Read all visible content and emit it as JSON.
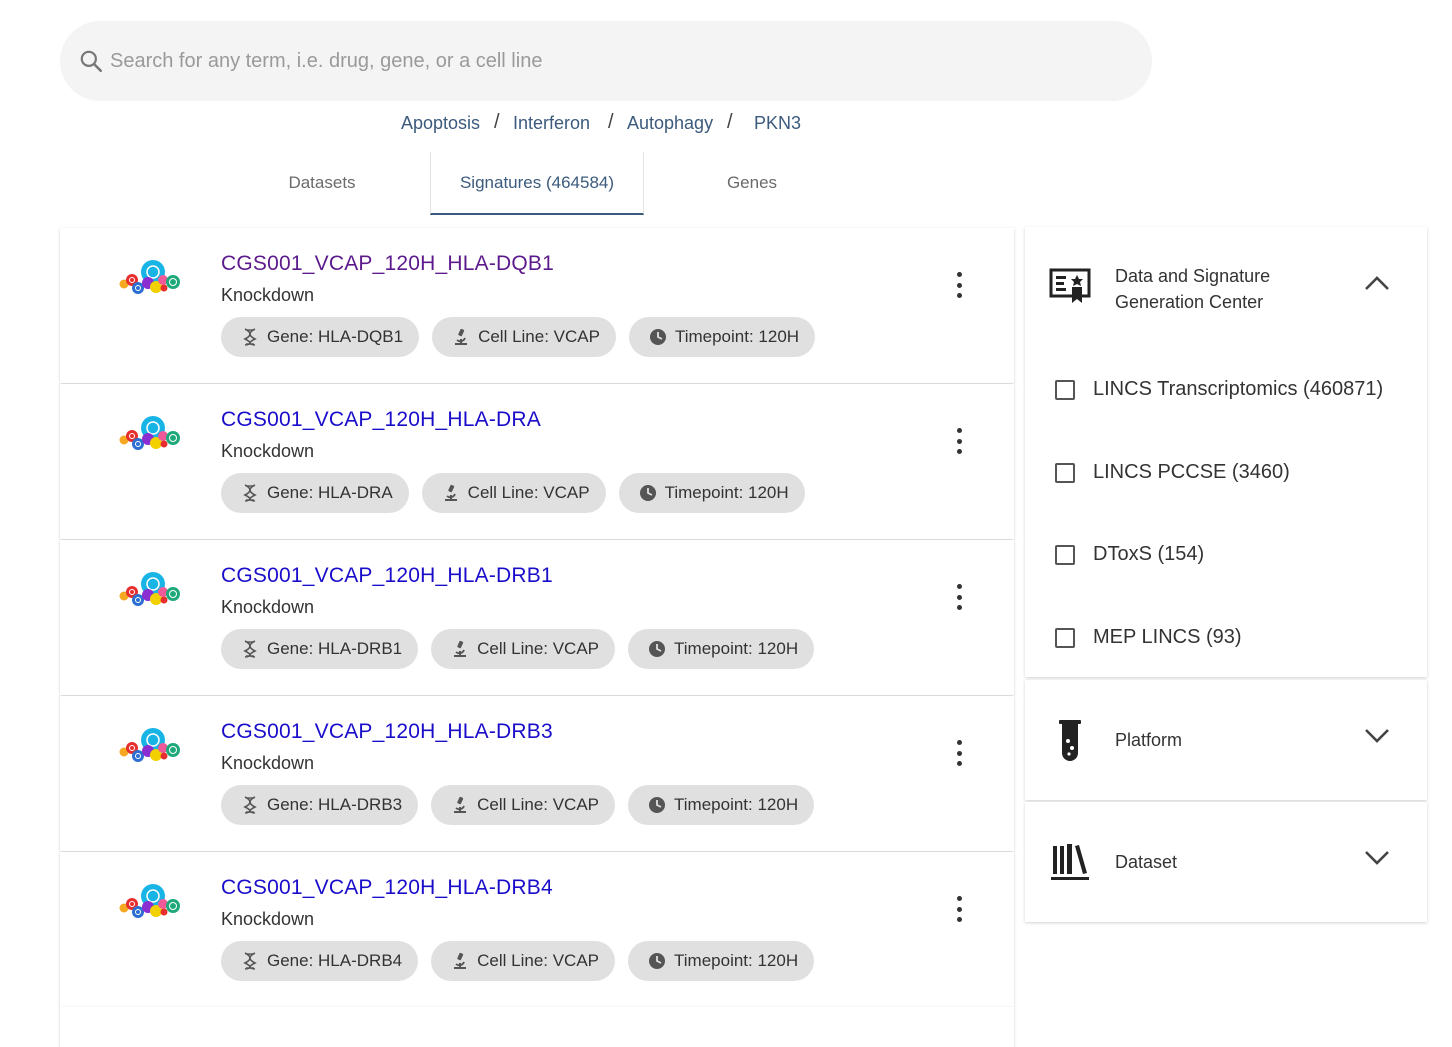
{
  "search": {
    "placeholder": "Search for any term, i.e. drug, gene, or a cell line"
  },
  "breadcrumbs": [
    "Apoptosis",
    "Interferon",
    "Autophagy",
    "PKN3"
  ],
  "breadcrumb_separator": "/",
  "tabs": [
    {
      "label": "Datasets",
      "active": false
    },
    {
      "label": "Signatures (464584)",
      "active": true
    },
    {
      "label": "Genes",
      "active": false
    }
  ],
  "signatures": [
    {
      "title": "CGS001_VCAP_120H_HLA-DQB1",
      "subtitle": "Knockdown",
      "visited": true,
      "chips": {
        "gene": "Gene: HLA-DQB1",
        "cell_line": "Cell Line: VCAP",
        "timepoint": "Timepoint: 120H"
      }
    },
    {
      "title": "CGS001_VCAP_120H_HLA-DRA",
      "subtitle": "Knockdown",
      "visited": false,
      "chips": {
        "gene": "Gene: HLA-DRA",
        "cell_line": "Cell Line: VCAP",
        "timepoint": "Timepoint: 120H"
      }
    },
    {
      "title": "CGS001_VCAP_120H_HLA-DRB1",
      "subtitle": "Knockdown",
      "visited": false,
      "chips": {
        "gene": "Gene: HLA-DRB1",
        "cell_line": "Cell Line: VCAP",
        "timepoint": "Timepoint: 120H"
      }
    },
    {
      "title": "CGS001_VCAP_120H_HLA-DRB3",
      "subtitle": "Knockdown",
      "visited": false,
      "chips": {
        "gene": "Gene: HLA-DRB3",
        "cell_line": "Cell Line: VCAP",
        "timepoint": "Timepoint: 120H"
      }
    },
    {
      "title": "CGS001_VCAP_120H_HLA-DRB4",
      "subtitle": "Knockdown",
      "visited": false,
      "chips": {
        "gene": "Gene: HLA-DRB4",
        "cell_line": "Cell Line: VCAP",
        "timepoint": "Timepoint: 120H"
      }
    }
  ],
  "filters": {
    "center": {
      "title_line1": "Data and Signature",
      "title_line2": "Generation Center",
      "expanded": true,
      "options": [
        {
          "label": "LINCS Transcriptomics (460871)",
          "checked": false
        },
        {
          "label": "LINCS PCCSE (3460)",
          "checked": false
        },
        {
          "label": "DToxS (154)",
          "checked": false
        },
        {
          "label": "MEP LINCS (93)",
          "checked": false
        }
      ]
    },
    "platform": {
      "title": "Platform",
      "expanded": false
    },
    "dataset": {
      "title": "Dataset",
      "expanded": false
    }
  },
  "colors": {
    "link": "#1a0dca",
    "visited_link": "#5c1a8c",
    "accent": "#3b5a7c",
    "chip_bg": "#e0e0e0"
  },
  "icons": {
    "search": "search-icon",
    "gene": "dna-icon",
    "cell_line": "microscope-icon",
    "timepoint": "clock-icon",
    "more": "more-vert-icon",
    "center": "certificate-icon",
    "platform": "test-tube-icon",
    "dataset": "library-icon"
  }
}
